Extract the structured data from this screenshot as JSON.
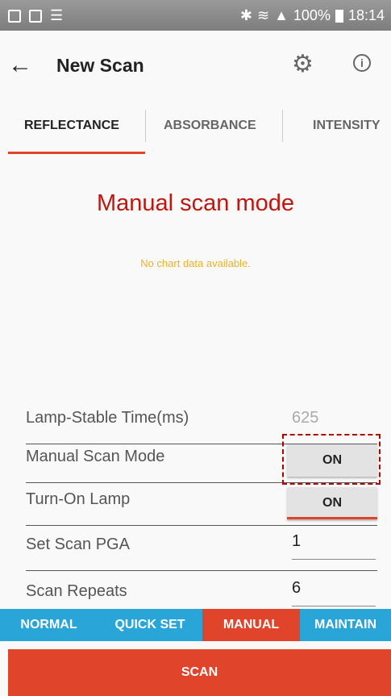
{
  "status_bar": {
    "battery": "100%",
    "time": "18:14"
  },
  "app_bar": {
    "title": "New Scan",
    "back_icon": "arrow-left-icon",
    "settings_icon": "gear-icon",
    "info_icon": "info-icon"
  },
  "tabs": [
    {
      "label": "REFLECTANCE",
      "selected": true
    },
    {
      "label": "ABSORBANCE",
      "selected": false
    },
    {
      "label": "INTENSITY",
      "selected": false
    }
  ],
  "main": {
    "mode_title": "Manual scan mode",
    "chart_message": "No chart data available."
  },
  "settings": {
    "lamp_stable_time": {
      "label": "Lamp-Stable Time(ms)",
      "value": "625"
    },
    "manual_scan_mode": {
      "label": "Manual Scan Mode",
      "value": "ON"
    },
    "turn_on_lamp": {
      "label": "Turn-On Lamp",
      "value": "ON"
    },
    "scan_pga": {
      "label": "Set Scan PGA",
      "value": "1"
    },
    "scan_repeats": {
      "label": "Scan Repeats",
      "value": "6"
    }
  },
  "bottom_tabs": [
    {
      "label": "NORMAL",
      "selected": false
    },
    {
      "label": "QUICK SET",
      "selected": false
    },
    {
      "label": "MANUAL",
      "selected": true
    },
    {
      "label": "MAINTAIN",
      "selected": false
    }
  ],
  "scan_button": "SCAN",
  "colors": {
    "accent": "#e0442b",
    "mode_title": "#c0160f",
    "tab_bar": "#2aa5d8",
    "warning_text": "#f0b020"
  }
}
